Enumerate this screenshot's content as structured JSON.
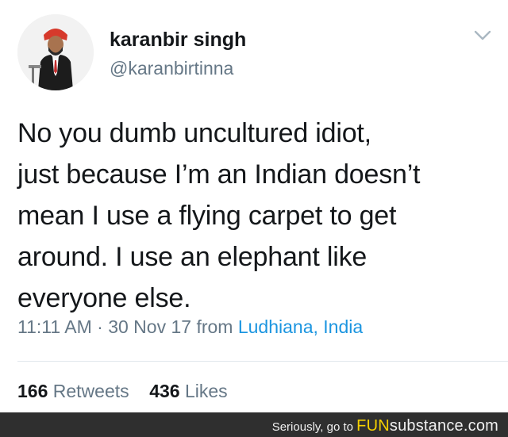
{
  "tweet": {
    "name": "karanbir singh",
    "handle": "@karanbirtinna",
    "body_lines": [
      "No you dumb uncultured idiot,",
      "just because I’m an Indian doesn’t",
      "mean I use a flying carpet to get",
      "around. I use an elephant like",
      "everyone else."
    ],
    "time": "11:11 AM · 30 Nov 17 from",
    "location": "Ludhiana, India",
    "retweets_count": "166",
    "retweets_label": "Retweets",
    "likes_count": "436",
    "likes_label": "Likes",
    "colors": {
      "name": "#14171a",
      "secondary": "#657786",
      "link": "#1b95e0"
    },
    "icons": {
      "menu": "chevron-down-icon",
      "avatar": "profile-photo"
    }
  },
  "footer": {
    "prefix": "Seriously, go to",
    "brand_fun": "FUN",
    "brand_substance": "substance",
    "brand_tld": ".com",
    "colors": {
      "background": "#2f2f2f",
      "highlight": "#f5d000"
    }
  }
}
